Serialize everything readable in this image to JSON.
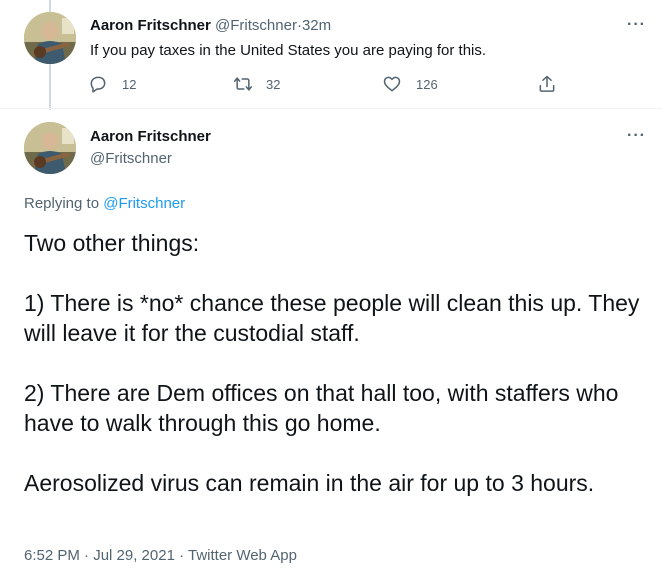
{
  "tweet1": {
    "author_name": "Aaron Fritschner",
    "author_handle": "@Fritschner",
    "separator": "·",
    "time": "32m",
    "text": "If you pay taxes in the United States you are paying for this.",
    "reply_count": "12",
    "retweet_count": "32",
    "like_count": "126",
    "more_icon": "···"
  },
  "tweet2": {
    "author_name": "Aaron Fritschner",
    "author_handle": "@Fritschner",
    "more_icon": "···",
    "replying_prefix": "Replying to",
    "replying_handle": "@Fritschner",
    "paragraphs": [
      "Two other things:",
      "1) There is *no* chance these people will clean this up. They will leave it for the custodial staff.",
      "2) There are Dem offices on that hall too, with staffers who have to walk through this go home.",
      "Aerosolized virus can remain in the air for up to 3 hours."
    ],
    "timestamp": "6:52 PM · Jul 29, 2021 · Twitter Web App"
  },
  "colors": {
    "text": "#0f1419",
    "muted": "#536471",
    "link": "#1d9bf0",
    "divider": "#eff3f4"
  }
}
